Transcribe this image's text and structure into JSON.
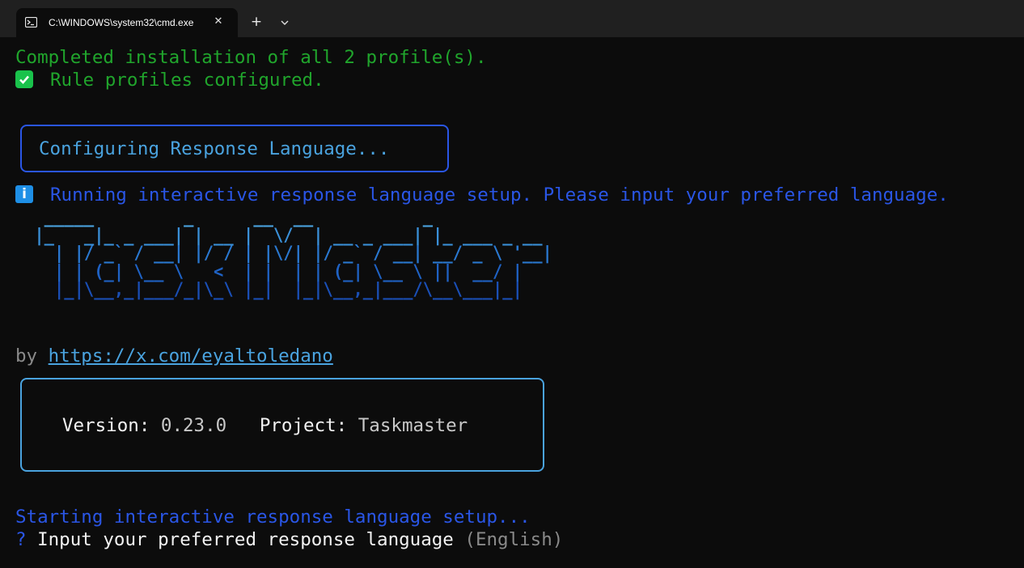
{
  "window": {
    "tab_title": "C:\\WINDOWS\\system32\\cmd.exe",
    "close_glyph": "✕",
    "new_tab_glyph": "+",
    "icon": "powershell-terminal-icon"
  },
  "terminal": {
    "line1": "Completed installation of all 2 profile(s).",
    "line2": "Rule profiles configured.",
    "box1": "Configuring Response Language...",
    "info": "Running interactive response language setup. Please input your preferred language.",
    "ascii_art": [
      "  _____         _      __  __           _",
      " |_   _|_ _ ___| | __ |  \\/  | __ _ ___| |_ ___ _ __",
      "   | |/ _` / __| |/ / | |\\/| |/ _` / __| __/ _ \\ '__|",
      "   | | (_| \\__ \\   <  | |  | | (_| \\__ \\ ||  __/ |",
      "   |_|\\__,_|___/_|\\_\\ |_|  |_|\\__,_|___/\\__\\___|_|"
    ],
    "by_prefix": "by ",
    "by_link": "https://x.com/eyaltoledano",
    "version_label": "Version: ",
    "version_value": "0.23.0",
    "project_label": "   Project: ",
    "project_value": "Taskmaster",
    "starting": "Starting interactive response language setup...",
    "prompt_mark": "?",
    "prompt": " Input your preferred response language ",
    "prompt_default": "(English)"
  },
  "colors": {
    "success_green": "#20a52c",
    "info_blue": "#2a56e6",
    "link_cyan": "#4aa3df",
    "ascii_gradient": [
      "#4aa3df",
      "#3a90d8",
      "#2a78d0",
      "#1f62c4",
      "#1a4fb6"
    ]
  }
}
